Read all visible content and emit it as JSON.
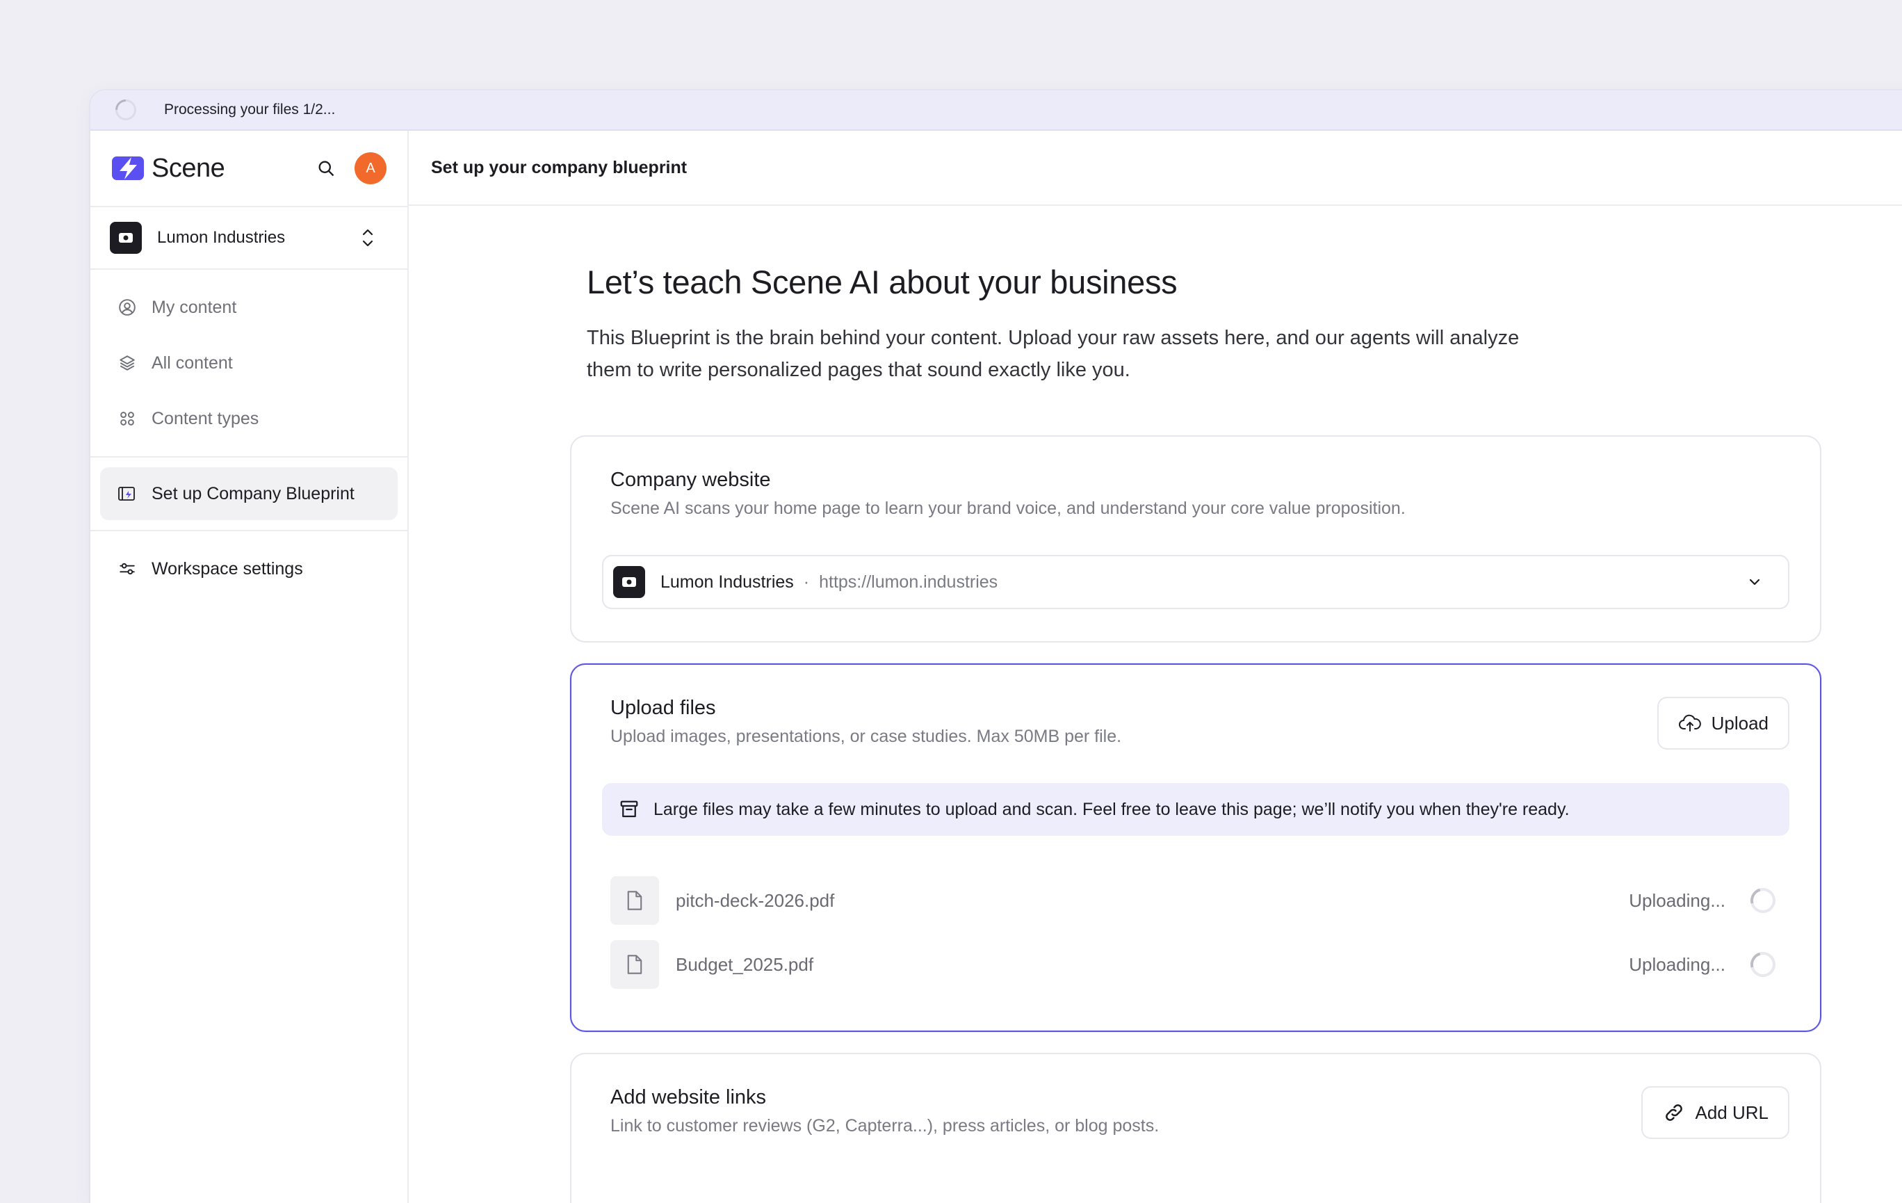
{
  "banner": {
    "text": "Processing your files 1/2..."
  },
  "sidebar": {
    "logo_text": "Scene",
    "avatar_initial": "A",
    "org_name": "Lumon Industries",
    "nav": [
      {
        "label": "My content",
        "icon": "user-circle-icon"
      },
      {
        "label": "All content",
        "icon": "layers-icon"
      },
      {
        "label": "Content types",
        "icon": "grid-icon"
      }
    ],
    "blueprint_item": {
      "label": "Set up Company Blueprint",
      "icon": "blueprint-icon"
    },
    "settings_item": {
      "label": "Workspace settings",
      "icon": "sliders-icon"
    }
  },
  "header": {
    "title": "Set up your company blueprint"
  },
  "main": {
    "heading": "Let’s teach Scene AI about your business",
    "intro": "This Blueprint is the brain behind your content. Upload your raw assets here, and our agents will analyze them to write personalized pages that sound exactly like you.",
    "website_card": {
      "title": "Company website",
      "subtitle": "Scene AI scans your home page to learn your brand voice, and understand your core value proposition.",
      "selected_name": "Lumon Industries",
      "separator": "·",
      "selected_url": "https://lumon.industries"
    },
    "upload_card": {
      "title": "Upload files",
      "subtitle": "Upload images, presentations, or case studies. Max 50MB per file.",
      "button_label": "Upload",
      "notice": "Large files may take a few minutes to upload and scan. Feel free to leave this page; we’ll notify you when they're ready.",
      "files": [
        {
          "name": "pitch-deck-2026.pdf",
          "status": "Uploading..."
        },
        {
          "name": "Budget_2025.pdf",
          "status": "Uploading..."
        }
      ]
    },
    "links_card": {
      "title": "Add website links",
      "subtitle": "Link to customer reviews (G2, Capterra...), press articles, or blog posts.",
      "button_label": "Add URL"
    }
  },
  "colors": {
    "accent": "#5b54e0",
    "avatar": "#f26a2b",
    "brand": "#5a4ff0"
  }
}
